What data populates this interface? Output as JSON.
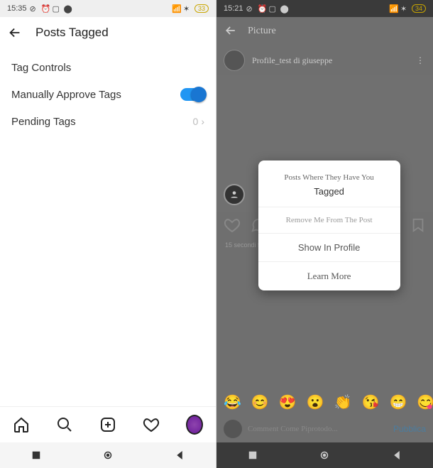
{
  "left": {
    "status": {
      "time": "15:35",
      "battery": "33"
    },
    "header": {
      "title": "Posts Tagged"
    },
    "tag_controls_label": "Tag Controls",
    "manually_approve_label": "Manually Approve Tags",
    "pending_tags_label": "Pending Tags",
    "pending_tags_count": "0"
  },
  "right": {
    "status": {
      "time": "15:21",
      "battery": "34"
    },
    "header": {
      "title": "Picture"
    },
    "profile_name": "Profile_test di giuseppe",
    "time_ago": "15 secondi fa",
    "dialog": {
      "title": "Posts Where They Have You",
      "subtitle": "Tagged",
      "remove": "Remove Me From The Post",
      "show": "Show In Profile",
      "learn": "Learn More"
    },
    "emoji": [
      "😂",
      "😊",
      "😍",
      "😮",
      "👏",
      "😘",
      "😁",
      "😋"
    ],
    "comment_placeholder": "Comment Come Piprotodo...",
    "publish": "Pubblica"
  }
}
